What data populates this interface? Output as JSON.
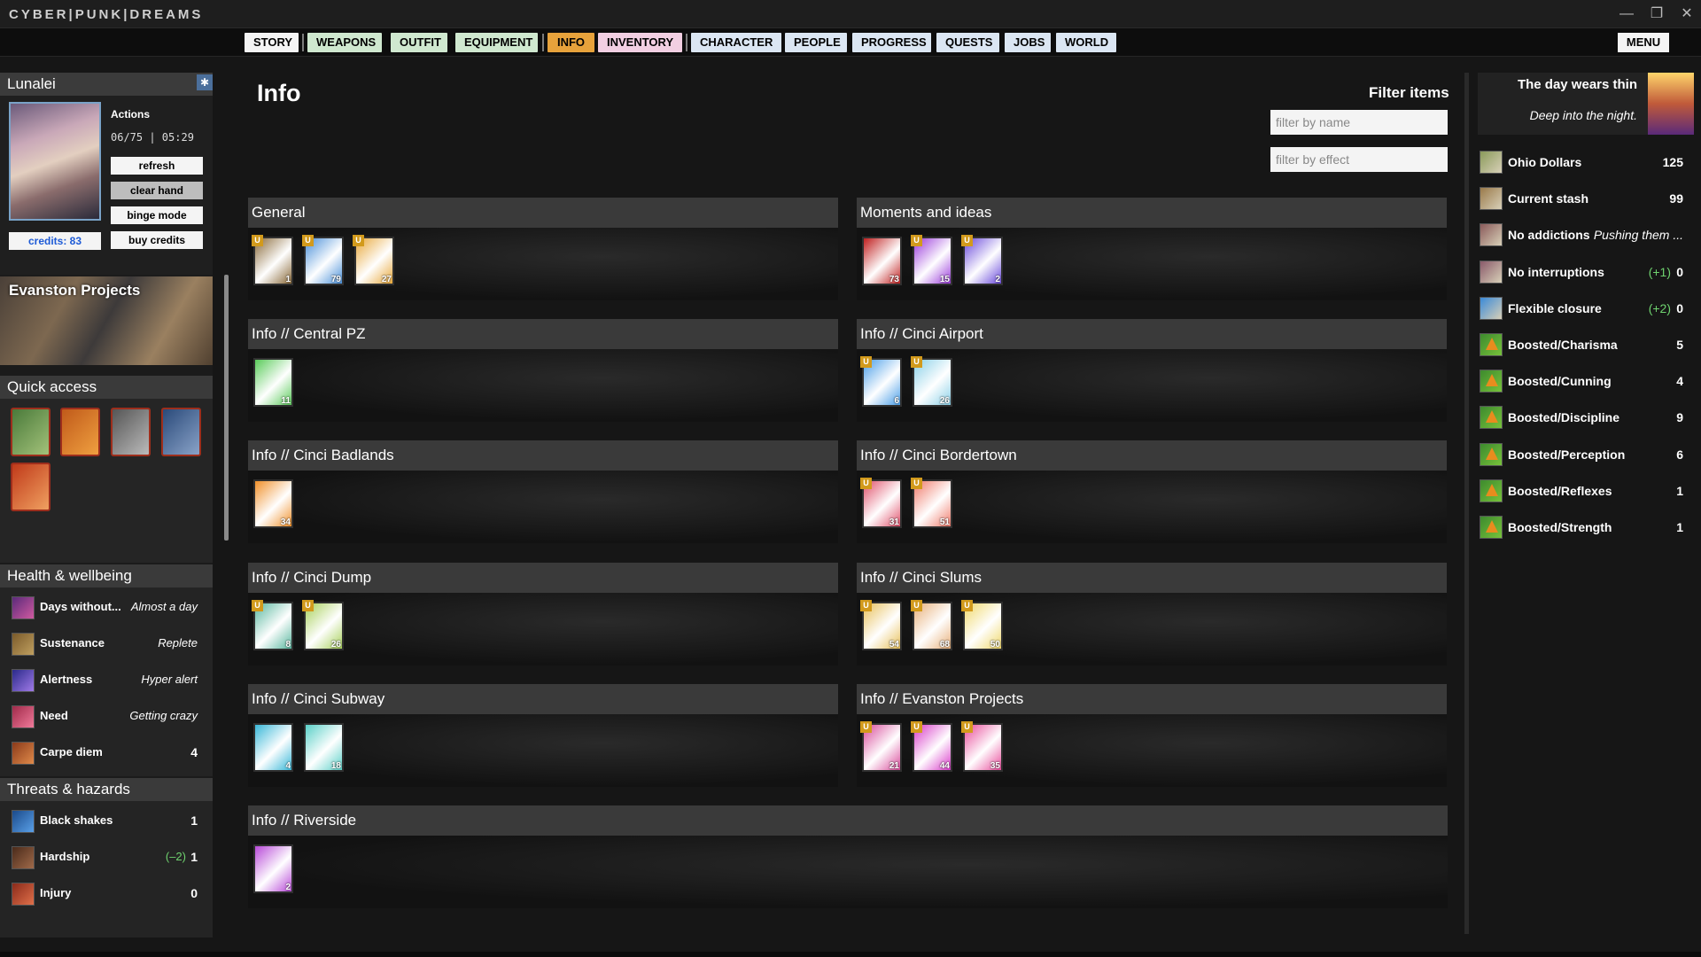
{
  "app": {
    "title": "CYBER|PUNK|DREAMS",
    "menu_label": "MENU"
  },
  "tabs": [
    {
      "label": "STORY"
    },
    {
      "label": "WEAPONS"
    },
    {
      "label": "OUTFIT"
    },
    {
      "label": "EQUIPMENT"
    },
    {
      "label": "INFO"
    },
    {
      "label": "INVENTORY"
    },
    {
      "label": "CHARACTER"
    },
    {
      "label": "PEOPLE"
    },
    {
      "label": "PROGRESS"
    },
    {
      "label": "QUESTS"
    },
    {
      "label": "JOBS"
    },
    {
      "label": "WORLD"
    }
  ],
  "profile": {
    "name": "Lunalei",
    "actions_title": "Actions",
    "actions_time": "06/75 | 05:29",
    "credits": "credits: 83",
    "buttons": [
      "refresh",
      "clear hand",
      "binge mode",
      "buy credits"
    ]
  },
  "location": {
    "title": "Evanston Projects"
  },
  "quick_access": {
    "title": "Quick access"
  },
  "health": {
    "title": "Health & wellbeing",
    "items": [
      {
        "name": "Days without...",
        "value": "Almost a day"
      },
      {
        "name": "Sustenance",
        "value": "Replete"
      },
      {
        "name": "Alertness",
        "value": "Hyper alert"
      },
      {
        "name": "Need",
        "value": "Getting crazy"
      },
      {
        "name": "Carpe diem",
        "value": "4"
      }
    ]
  },
  "threats": {
    "title": "Threats & hazards",
    "items": [
      {
        "name": "Black shakes",
        "mod": "",
        "value": "1"
      },
      {
        "name": "Hardship",
        "mod": "(–2)",
        "value": "1"
      },
      {
        "name": "Injury",
        "mod": "",
        "value": "0"
      }
    ]
  },
  "main": {
    "title": "Info",
    "filter_title": "Filter items",
    "filter_name_placeholder": "filter by name",
    "filter_effect_placeholder": "filter by effect"
  },
  "sections": [
    {
      "title": "General",
      "cards": [
        {
          "count": "1",
          "u": true,
          "color": "#8a6a3a"
        },
        {
          "count": "79",
          "u": true,
          "color": "#4a90d9"
        },
        {
          "count": "27",
          "u": true,
          "color": "#e8a83a"
        }
      ]
    },
    {
      "title": "Moments and ideas",
      "cards": [
        {
          "count": "73",
          "u": false,
          "color": "#c02020"
        },
        {
          "count": "15",
          "u": true,
          "color": "#9a3adb"
        },
        {
          "count": "2",
          "u": true,
          "color": "#6a4adb"
        }
      ]
    },
    {
      "title": "Info // Central PZ",
      "cards": [
        {
          "count": "11",
          "u": false,
          "color": "#5acb5a"
        }
      ]
    },
    {
      "title": "Info // Cinci Airport",
      "cards": [
        {
          "count": "6",
          "u": true,
          "color": "#4a9ee8"
        },
        {
          "count": "26",
          "u": true,
          "color": "#8ad0e8"
        }
      ]
    },
    {
      "title": "Info // Cinci Badlands",
      "cards": [
        {
          "count": "34",
          "u": false,
          "color": "#f0902a"
        }
      ]
    },
    {
      "title": "Info // Cinci Bordertown",
      "cards": [
        {
          "count": "31",
          "u": true,
          "color": "#e0506a"
        },
        {
          "count": "51",
          "u": true,
          "color": "#f07a6a"
        }
      ]
    },
    {
      "title": "Info // Cinci Dump",
      "cards": [
        {
          "count": "8",
          "u": true,
          "color": "#5ab8a0"
        },
        {
          "count": "26",
          "u": true,
          "color": "#a8d05a"
        }
      ]
    },
    {
      "title": "Info // Cinci Slums",
      "cards": [
        {
          "count": "54",
          "u": true,
          "color": "#e8c05a"
        },
        {
          "count": "68",
          "u": true,
          "color": "#e8b07a"
        },
        {
          "count": "50",
          "u": true,
          "color": "#f0d86a"
        }
      ]
    },
    {
      "title": "Info // Cinci Subway",
      "cards": [
        {
          "count": "4",
          "u": false,
          "color": "#3ab8d8"
        },
        {
          "count": "18",
          "u": false,
          "color": "#5ad0c8"
        }
      ]
    },
    {
      "title": "Info // Evanston Projects",
      "cards": [
        {
          "count": "21",
          "u": true,
          "color": "#d84a9a"
        },
        {
          "count": "44",
          "u": true,
          "color": "#d83ac8"
        },
        {
          "count": "35",
          "u": true,
          "color": "#e84a9a"
        }
      ]
    },
    {
      "title": "Info // Riverside",
      "cards": [
        {
          "count": "2",
          "u": false,
          "color": "#b84ad8"
        }
      ]
    }
  ],
  "day": {
    "title": "The day wears thin",
    "subtitle": "Deep into the night."
  },
  "resources": [
    {
      "name": "Ohio Dollars",
      "mod": "",
      "value": "125",
      "italic": false
    },
    {
      "name": "Current stash",
      "mod": "",
      "value": "99",
      "italic": false
    },
    {
      "name": "No addictions",
      "mod": "",
      "value": "Pushing them ...",
      "italic": true
    },
    {
      "name": "No interruptions",
      "mod": "(+1)",
      "value": "0",
      "italic": false
    },
    {
      "name": "Flexible closure",
      "mod": "(+2)",
      "value": "0",
      "italic": false
    },
    {
      "name": "Boosted/Charisma",
      "mod": "",
      "value": "5",
      "italic": false
    },
    {
      "name": "Boosted/Cunning",
      "mod": "",
      "value": "4",
      "italic": false
    },
    {
      "name": "Boosted/Discipline",
      "mod": "",
      "value": "9",
      "italic": false
    },
    {
      "name": "Boosted/Perception",
      "mod": "",
      "value": "6",
      "italic": false
    },
    {
      "name": "Boosted/Reflexes",
      "mod": "",
      "value": "1",
      "italic": false
    },
    {
      "name": "Boosted/Strength",
      "mod": "",
      "value": "1",
      "italic": false
    }
  ]
}
